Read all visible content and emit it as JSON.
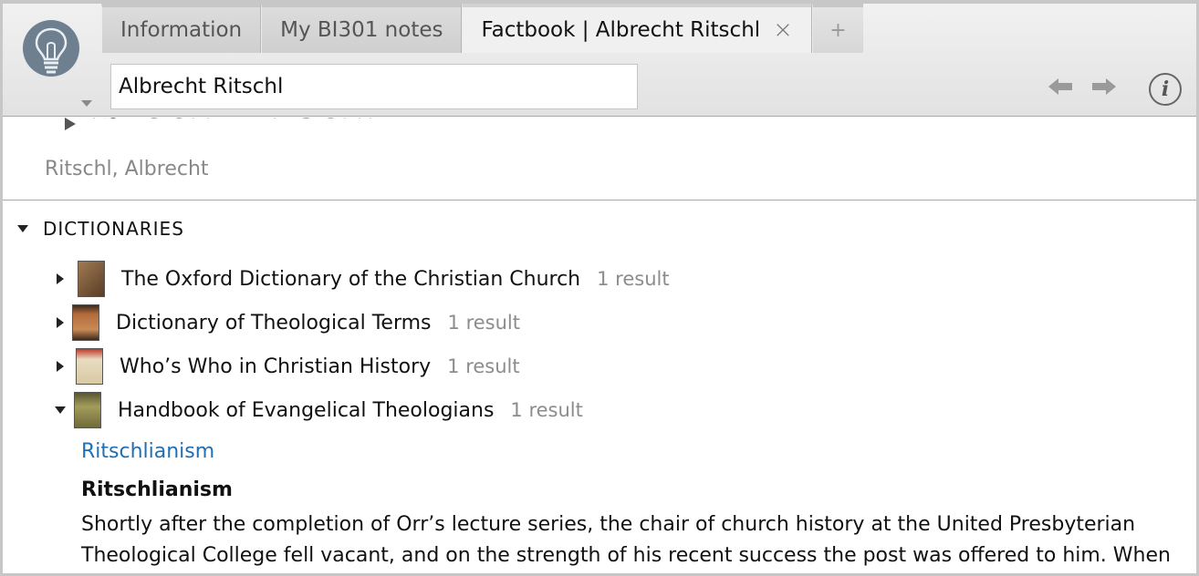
{
  "tabs": [
    {
      "label": "Information"
    },
    {
      "label": "My BI301 notes"
    },
    {
      "label": "Factbook | Albrecht Ritschl",
      "active": true
    }
  ],
  "add_tab_label": "+",
  "close_tab_label": "×",
  "search": {
    "value": "Albrecht Ritschl"
  },
  "icons": {
    "app": "lightbulb-icon",
    "back": "arrow-left-icon",
    "forward": "arrow-right-icon",
    "info": "info-icon"
  },
  "info_label": "i",
  "page": {
    "title": "Albrecht Ritschl",
    "subtitle": "Ritschl, Albrecht"
  },
  "dictionaries": {
    "header": "DICTIONARIES",
    "items": [
      {
        "title": "The Oxford Dictionary of the Christian Church",
        "count": "1 result",
        "expanded": false,
        "cover_color": "#8a6a4a"
      },
      {
        "title": "Dictionary of Theological Terms",
        "count": "1 result",
        "expanded": false,
        "cover_color": "#9c4f2a"
      },
      {
        "title": "Who’s Who in Christian History",
        "count": "1 result",
        "expanded": false,
        "cover_color": "#d9c9a5"
      },
      {
        "title": "Handbook of Evangelical Theologians",
        "count": "1 result",
        "expanded": true,
        "cover_color": "#6f6a3a"
      }
    ]
  },
  "article": {
    "link": "Ritschlianism",
    "heading": "Ritschlianism",
    "body": "Shortly after the completion of Orr’s lecture series, the chair of church history at the United Presbyterian Theological College fell vacant, and on the strength of his recent success the post was offered to him. When"
  },
  "colors": {
    "accent_link": "#1f6fb7",
    "muted_text": "#888888",
    "bulb_bg": "#6e7f90"
  }
}
